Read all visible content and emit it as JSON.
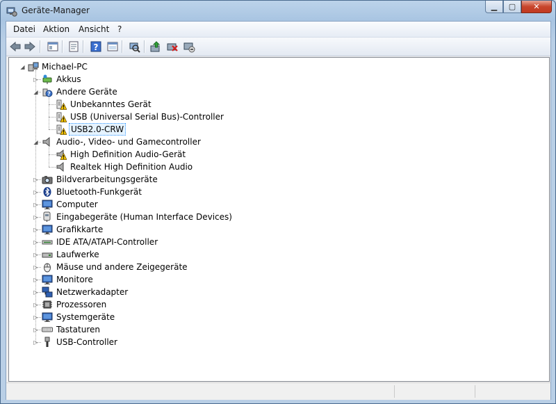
{
  "window": {
    "title": "Geräte-Manager"
  },
  "menu": [
    "Datei",
    "Aktion",
    "Ansicht",
    "?"
  ],
  "toolbar": {
    "buttons": [
      "back-icon",
      "forward-icon",
      "show-hide-tree-icon",
      "properties-icon",
      "help-icon",
      "view-icon",
      "scan-hardware-icon",
      "update-driver-icon",
      "uninstall-icon",
      "disable-icon"
    ]
  },
  "tree": {
    "root": "Michael-PC",
    "nodes": [
      {
        "label": "Akkus"
      },
      {
        "label": "Andere Geräte"
      },
      {
        "label": "Unbekanntes Gerät"
      },
      {
        "label": "USB (Universal Serial Bus)-Controller"
      },
      {
        "label": "USB2.0-CRW"
      },
      {
        "label": "Audio-, Video- und Gamecontroller"
      },
      {
        "label": "High Definition Audio-Gerät"
      },
      {
        "label": "Realtek High Definition Audio"
      },
      {
        "label": "Bildverarbeitungsgeräte"
      },
      {
        "label": "Bluetooth-Funkgerät"
      },
      {
        "label": "Computer"
      },
      {
        "label": "Eingabegeräte (Human Interface Devices)"
      },
      {
        "label": "Grafikkarte"
      },
      {
        "label": "IDE ATA/ATAPI-Controller"
      },
      {
        "label": "Laufwerke"
      },
      {
        "label": "Mäuse und andere Zeigegeräte"
      },
      {
        "label": "Monitore"
      },
      {
        "label": "Netzwerkadapter"
      },
      {
        "label": "Prozessoren"
      },
      {
        "label": "Systemgeräte"
      },
      {
        "label": "Tastaturen"
      },
      {
        "label": "USB-Controller"
      }
    ]
  },
  "colors": {
    "selection_border": "#3399ff",
    "warning": "#f2c200",
    "close": "#c7452c"
  }
}
